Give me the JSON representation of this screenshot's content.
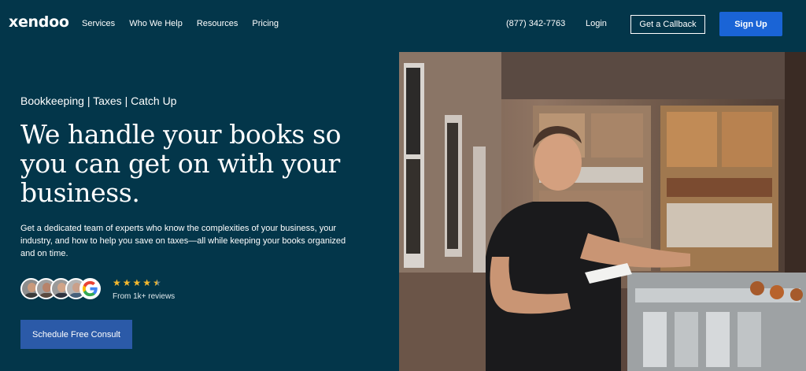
{
  "header": {
    "logo": "xendoo",
    "nav": [
      "Services",
      "Who We Help",
      "Resources",
      "Pricing"
    ],
    "phone": "(877) 342-7763",
    "login": "Login",
    "callback_label": "Get a Callback",
    "signup_label": "Sign Up"
  },
  "hero": {
    "eyebrow": "Bookkeeping | Taxes | Catch Up",
    "headline": "We handle your books so you can get on with your business.",
    "subcopy": "Get a dedicated team of experts who know the complexities of your business, your industry, and how to help you save on taxes—all while keeping your books organized and on time.",
    "rating": 4.5,
    "reviews_text": "From 1k+ reviews",
    "cta_label": "Schedule Free Consult"
  },
  "colors": {
    "background": "#03364a",
    "primary_button": "#1a64d6",
    "cta_button": "#2b5aa8",
    "star": "#f5b82e"
  }
}
